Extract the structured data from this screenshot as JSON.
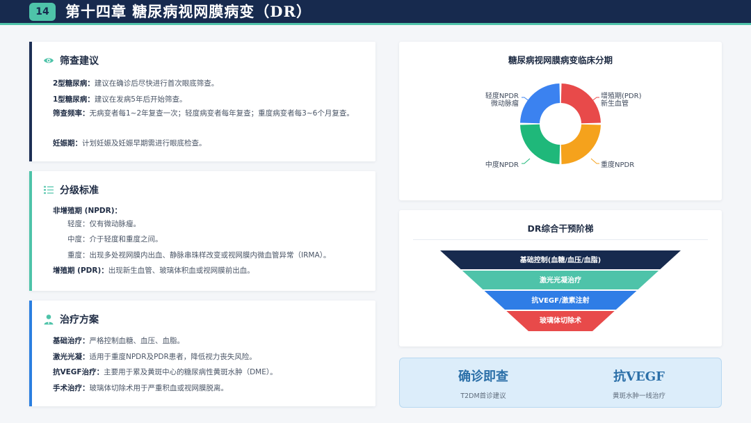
{
  "header": {
    "chapter_no": "14",
    "title": "第十四章 糖尿病视网膜病变（DR）"
  },
  "screening": {
    "title": "筛查建议",
    "lines": [
      {
        "label": "2型糖尿病：",
        "text": "建议在确诊后尽快进行首次眼底筛查。"
      },
      {
        "label": "1型糖尿病：",
        "text": "建议在发病5年后开始筛查。"
      },
      {
        "label": "筛查频率：",
        "text": "无病变者每1~2年复查一次；轻度病变者每年复查；重度病变者每3~6个月复查。"
      },
      {
        "label": "妊娠期：",
        "text": "计划妊娠及妊娠早期需进行眼底检查。"
      }
    ]
  },
  "grading": {
    "title": "分级标准",
    "npdr_label": "非增殖期 (NPDR)：",
    "npdr_items": [
      "轻度：仅有微动脉瘤。",
      "中度：介于轻度和重度之间。",
      "重度：出现多处视网膜内出血、静脉串珠样改变或视网膜内微血管异常（IRMA）。"
    ],
    "pdr_label": "增殖期 (PDR)：",
    "pdr_text": "出现新生血管、玻璃体积血或视网膜前出血。"
  },
  "treatment": {
    "title": "治疗方案",
    "lines": [
      {
        "label": "基础治疗：",
        "text": "严格控制血糖、血压、血脂。"
      },
      {
        "label": "激光光凝：",
        "text": "适用于重度NPDR及PDR患者，降低视力丧失风险。"
      },
      {
        "label": "抗VEGF治疗：",
        "text": "主要用于累及黄斑中心的糖尿病性黄斑水肿（DME）。"
      },
      {
        "label": "手术治疗：",
        "text": "玻璃体切除术用于严重积血或视网膜脱离。"
      }
    ]
  },
  "donut": {
    "title": "糖尿病视网膜病变临床分期",
    "segments": [
      {
        "line1": "增殖期(PDR)",
        "line2": "新生血管",
        "color": "#e84a4a",
        "share": 0.25
      },
      {
        "line1": "重度NPDR",
        "line2": "",
        "color": "#f5a21c",
        "share": 0.25
      },
      {
        "line1": "中度NPDR",
        "line2": "",
        "color": "#1fb87a",
        "share": 0.25
      },
      {
        "line1": "轻度NPDR",
        "line2": "微动脉瘤",
        "color": "#3b82f0",
        "share": 0.25
      }
    ]
  },
  "funnel": {
    "title": "DR综合干预阶梯",
    "levels": [
      {
        "label": "基础控制(血糖/血压/血脂)",
        "color": "#172a4e"
      },
      {
        "label": "激光光凝治疗",
        "color": "#4ec3a9"
      },
      {
        "label": "抗VEGF/激素注射",
        "color": "#2f7de6"
      },
      {
        "label": "玻璃体切除术",
        "color": "#e84a4a"
      }
    ]
  },
  "highlights": [
    {
      "big": "确诊即查",
      "small": "T2DM首诊建议"
    },
    {
      "big": "抗VEGF",
      "small": "黄斑水肿一线治疗"
    }
  ],
  "colors": {
    "navy": "#172a4e",
    "teal": "#4ec3a9",
    "blue": "#2b7fe0"
  }
}
